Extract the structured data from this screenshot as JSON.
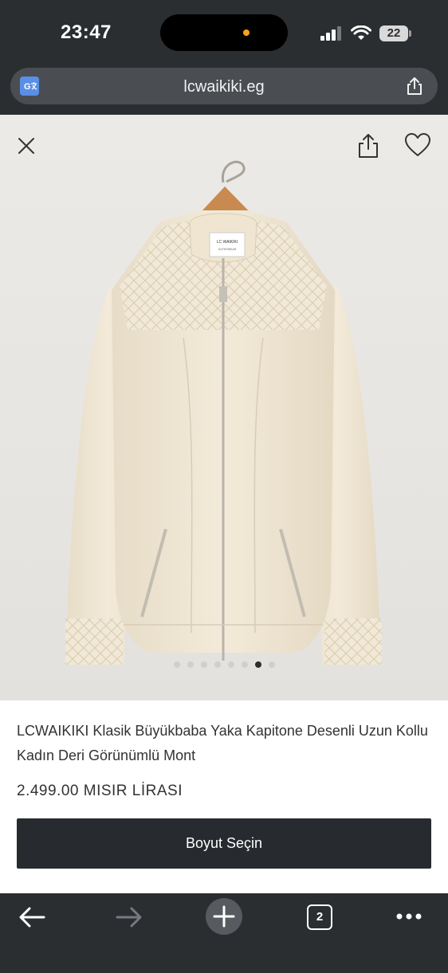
{
  "status_bar": {
    "time": "23:47",
    "battery": "22"
  },
  "address_bar": {
    "url": "lcwaikiki.eg"
  },
  "product": {
    "title": "LCWAIKIKI Klasik Büyükbaba Yaka Kapitone Desenli Uzun Kollu Kadın Deri Görünümlü Mont",
    "price": "2.499,00 MISIR LİRASI",
    "select_size_label": "Boyut Seçin",
    "image_count": 8,
    "active_image_index": 6,
    "label_brand": "LC WAIKIKI",
    "label_sub": "OUTERWEAR"
  },
  "toolbar": {
    "tab_count": "2"
  },
  "colors": {
    "chrome": "#2b2e31",
    "button": "#272a2e",
    "jacket": "#efe6d3"
  }
}
